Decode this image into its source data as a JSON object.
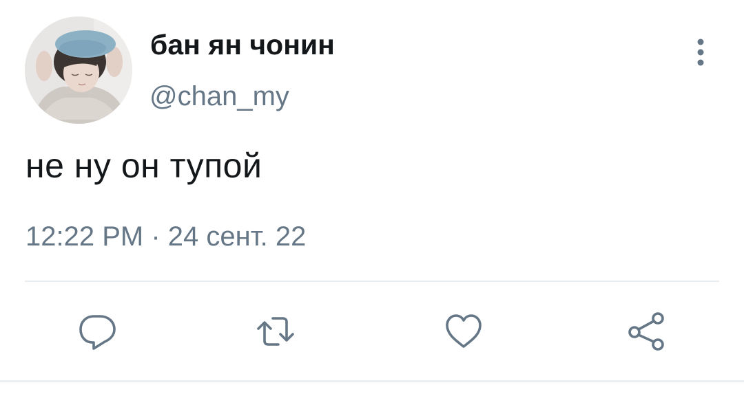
{
  "tweet": {
    "display_name": "бан ян чонин",
    "handle": "@chan_my",
    "text": "не ну он тупой",
    "time": "12:22 PM",
    "separator": "·",
    "date": "24 сент. 22"
  },
  "icons": {
    "avatar": "avatar-photo",
    "more": "more-vertical-icon",
    "reply": "reply-icon",
    "retweet": "retweet-icon",
    "like": "heart-icon",
    "share": "share-icon"
  },
  "colors": {
    "text_primary": "#14171a",
    "text_secondary": "#657786",
    "icon": "#657786",
    "divider": "#e6ecf0"
  }
}
